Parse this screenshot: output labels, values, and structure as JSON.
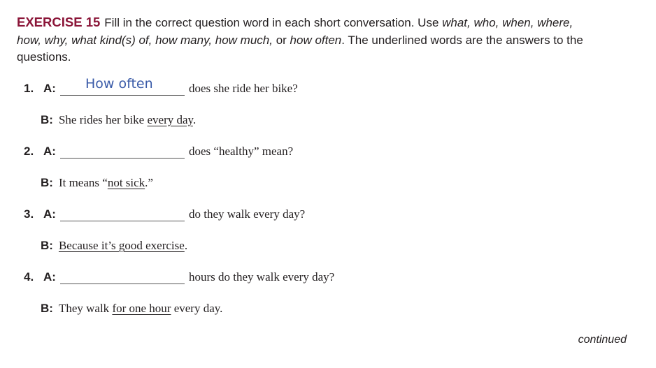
{
  "exercise": {
    "title": "EXERCISE 15",
    "intro": "Fill in the correct question word in each short conversation. Use ",
    "words": "what, who, when, where, how, why, what kind(s) of, how many, how much,",
    "or": " or ",
    "last_word": "how often",
    "outro": ". The underlined words are the answers to the questions."
  },
  "items": [
    {
      "number": "1.",
      "a_label": "A:",
      "answer": "How often",
      "question": "does she ride her bike?",
      "b_label": "B:",
      "b_pre": "She rides her bike ",
      "b_under": "every day",
      "b_post": "."
    },
    {
      "number": "2.",
      "a_label": "A:",
      "answer": "",
      "question": "does “healthy” mean?",
      "b_label": "B:",
      "b_pre": "It means “",
      "b_under": "not sick",
      "b_post": ".”"
    },
    {
      "number": "3.",
      "a_label": "A:",
      "answer": "",
      "question": "do they walk every day?",
      "b_label": "B:",
      "b_pre": "",
      "b_under": "Because it’s good exercise",
      "b_post": "."
    },
    {
      "number": "4.",
      "a_label": "A:",
      "answer": "",
      "question": "hours do they walk every day?",
      "b_label": "B:",
      "b_pre": "They walk ",
      "b_under": "for one hour",
      "b_post": " every day."
    }
  ],
  "footer": {
    "continued": "continued"
  }
}
